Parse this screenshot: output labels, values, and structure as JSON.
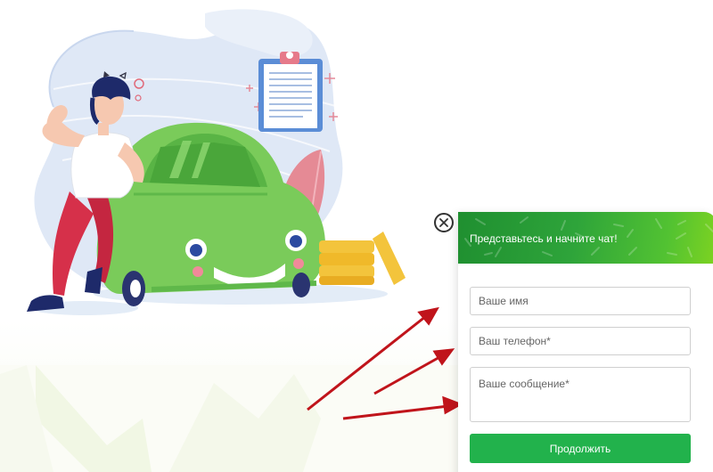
{
  "chat": {
    "title": "Представьтесь и начните чат!",
    "name_placeholder": "Ваше имя",
    "phone_placeholder": "Ваш телефон*",
    "message_placeholder": "Ваше сообщение*",
    "submit_label": "Продолжить"
  },
  "icons": {
    "close": "close-icon"
  },
  "colors": {
    "header_green": "#2ea43a",
    "submit_green": "#22b24c",
    "car_green": "#7acb5a",
    "arrow_red": "#c0141b"
  }
}
